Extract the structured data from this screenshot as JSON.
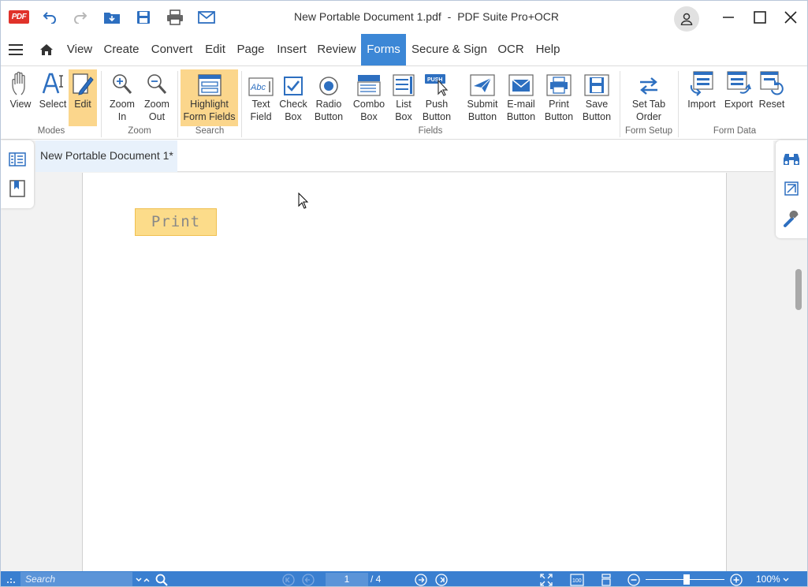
{
  "app": {
    "logo": "PDF",
    "document_title": "New Portable Document 1.pdf",
    "separator": "-",
    "app_name": "PDF Suite Pro+OCR"
  },
  "menu": [
    {
      "label": "View"
    },
    {
      "label": "Create"
    },
    {
      "label": "Convert"
    },
    {
      "label": "Edit"
    },
    {
      "label": "Page"
    },
    {
      "label": "Insert"
    },
    {
      "label": "Review"
    },
    {
      "label": "Forms"
    },
    {
      "label": "Secure & Sign"
    },
    {
      "label": "OCR"
    },
    {
      "label": "Help"
    }
  ],
  "active_menu": "Forms",
  "ribbon": {
    "modes": {
      "label": "Modes",
      "view": "View",
      "select": "Select",
      "edit": "Edit"
    },
    "zoom": {
      "label": "Zoom",
      "zoom_in": "Zoom\nIn",
      "zoom_out": "Zoom\nOut"
    },
    "search": {
      "label": "Search",
      "highlight": "Highlight\nForm Fields"
    },
    "fields": {
      "label": "Fields",
      "text_field": "Text\nField",
      "check_box": "Check\nBox",
      "radio_button": "Radio\nButton",
      "combo_box": "Combo\nBox",
      "list_box": "List\nBox",
      "push_button": "Push\nButton",
      "submit_button": "Submit\nButton",
      "email_button": "E-mail\nButton",
      "print_button": "Print\nButton",
      "save_button": "Save\nButton"
    },
    "form_setup": {
      "label": "Form Setup",
      "set_tab_order": "Set Tab\nOrder"
    },
    "form_data": {
      "label": "Form Data",
      "import": "Import",
      "export": "Export",
      "reset": "Reset"
    }
  },
  "icons": {
    "text_field_glyph": "Abc",
    "push_button_glyph": "PUSH"
  },
  "document": {
    "tab_label": "New Portable Document 1*",
    "print_field_text": "Print"
  },
  "status": {
    "search_placeholder": "Search",
    "current_page": "1",
    "total_pages": "/ 4",
    "fit_label": "100",
    "zoom": "100% "
  },
  "colors": {
    "accent": "#3c87d6",
    "statusbar": "#3a7fd0",
    "active_button": "#fbd68c",
    "form_field": "#fcdc8a",
    "logo_red": "#e0322a"
  }
}
